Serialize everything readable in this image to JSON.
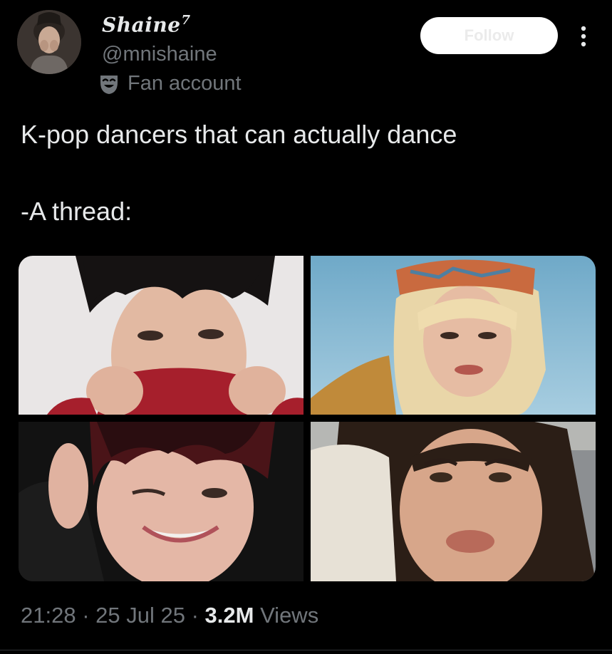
{
  "author": {
    "display_name": "Shaine",
    "display_name_suffix": "7",
    "handle": "@mnishaine",
    "label": "Fan account",
    "label_icon": "mask-icon"
  },
  "actions": {
    "follow_label": "Follow",
    "more_icon": "more-vertical-icon"
  },
  "tweet": {
    "text_line_1": "K-pop dancers that can actually dance",
    "text_line_2": "-A thread:"
  },
  "media": [
    {
      "description": "photo-1"
    },
    {
      "description": "photo-2"
    },
    {
      "description": "photo-3"
    },
    {
      "description": "photo-4"
    }
  ],
  "meta": {
    "time": "21:28",
    "separator": " · ",
    "date": "25 Jul 25",
    "views_count": "3.2M",
    "views_label": " Views"
  },
  "colors": {
    "background": "#000000",
    "primary_text": "#e7e9ea",
    "secondary_text": "#71767b",
    "follow_button": "#ffffff"
  }
}
